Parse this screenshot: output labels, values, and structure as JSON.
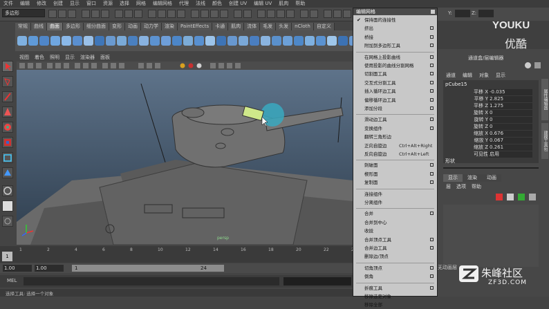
{
  "menubar": [
    "文件",
    "编辑",
    "修改",
    "创建",
    "显示",
    "窗口",
    "资源",
    "选择",
    "网格",
    "编辑网格",
    "代理",
    "法线",
    "颜色",
    "创建 UV",
    "编辑 UV",
    "肌肉",
    "帮助"
  ],
  "mode_select": "多边形",
  "field_labels": {
    "y": "Y:",
    "z": "Z:"
  },
  "shelf_tabs": [
    "常规",
    "曲线",
    "曲面",
    "多边形",
    "细分曲面",
    "变形",
    "动画",
    "动力学",
    "渲染",
    "PaintEffects",
    "卡通",
    "肌肉",
    "流体",
    "毛发",
    "头发",
    "nCloth",
    "自定义"
  ],
  "shelf_active": 2,
  "viewport_menu": [
    "视图",
    "着色",
    "照明",
    "显示",
    "渲染器",
    "面板"
  ],
  "timeline": {
    "ticks": [
      "1",
      "2",
      "4",
      "6",
      "8",
      "10",
      "12",
      "14",
      "16",
      "18",
      "20",
      "22",
      "24"
    ],
    "current_frame": "1",
    "start_field": "1.00",
    "range_start": "1.00",
    "range_box_start": "1",
    "range_box_end": "24",
    "anim_pref_text": "无动画层",
    "mel_label": "MEL",
    "help_text": "选择工具: 选择一个对象"
  },
  "right_panel": {
    "header": "通道盒/层编辑器",
    "tabs": [
      "通道",
      "编辑",
      "对象",
      "显示"
    ],
    "object": "pCube15",
    "channels": [
      {
        "name": "平移 X",
        "value": "-0.035"
      },
      {
        "name": "平移 Y",
        "value": "2.825"
      },
      {
        "name": "平移 Z",
        "value": "1.275"
      },
      {
        "name": "旋转 X",
        "value": "0"
      },
      {
        "name": "旋转 Y",
        "value": "0"
      },
      {
        "name": "旋转 Z",
        "value": "0"
      },
      {
        "name": "缩放 X",
        "value": "0.676"
      },
      {
        "name": "缩放 Y",
        "value": "0.067"
      },
      {
        "name": "缩放 Z",
        "value": "0.261"
      },
      {
        "name": "可见性",
        "value": "启用"
      }
    ],
    "shapes_label": "形状",
    "layer_tabs": [
      "显示",
      "渲染",
      "动画"
    ],
    "layer_menu": [
      "层",
      "选项",
      "帮助"
    ],
    "side_tabs": [
      "属性编辑器",
      "建模工具包"
    ]
  },
  "edit_mesh_menu": {
    "title": "编辑网格",
    "items": [
      {
        "label": "保持面的连接性",
        "check": true,
        "opt": false
      },
      {
        "label": "挤出",
        "opt": true
      },
      {
        "label": "桥接",
        "opt": true
      },
      {
        "label": "附加到多边形工具",
        "opt": true
      },
      {
        "sep": true
      },
      {
        "label": "在网格上投影曲线",
        "opt": true
      },
      {
        "label": "使用投影的曲线分割网格",
        "opt": true
      },
      {
        "label": "切割面工具",
        "opt": true
      },
      {
        "label": "交互式分割工具",
        "opt": true
      },
      {
        "label": "插入循环边工具",
        "opt": true
      },
      {
        "label": "偏移循环边工具",
        "opt": true
      },
      {
        "label": "添加分段",
        "opt": true
      },
      {
        "sep": true
      },
      {
        "label": "滑动边工具",
        "opt": true
      },
      {
        "label": "变换组件",
        "opt": true
      },
      {
        "label": "翻转三角形边",
        "opt": false
      },
      {
        "label": "正向自旋边",
        "shortcut": "Ctrl+Alt+Right",
        "opt": false
      },
      {
        "label": "反向自旋边",
        "shortcut": "Ctrl+Alt+Left",
        "opt": false
      },
      {
        "sep": true
      },
      {
        "label": "刺破面",
        "opt": true
      },
      {
        "label": "楔形面",
        "opt": true
      },
      {
        "label": "复制面",
        "opt": true
      },
      {
        "sep": true
      },
      {
        "label": "连接组件",
        "opt": false
      },
      {
        "label": "分离组件",
        "opt": false
      },
      {
        "sep": true
      },
      {
        "label": "合并",
        "opt": true
      },
      {
        "label": "合并到中心",
        "opt": false
      },
      {
        "label": "收拢",
        "opt": false
      },
      {
        "label": "合并顶点工具",
        "opt": true
      },
      {
        "label": "合并边工具",
        "opt": true
      },
      {
        "label": "删除边/顶点",
        "opt": false
      },
      {
        "sep": true
      },
      {
        "label": "切角顶点",
        "opt": true
      },
      {
        "label": "倒角",
        "opt": true
      },
      {
        "sep": true
      },
      {
        "label": "折痕工具",
        "opt": true
      },
      {
        "label": "移除选定对象",
        "opt": false
      },
      {
        "label": "移除全部",
        "opt": false
      }
    ]
  },
  "watermarks": {
    "youku_latin": "YOUKU",
    "youku_cn": "优酷",
    "zf3d_cn": "朱峰社区",
    "zf3d_url": "ZF3D.COM"
  },
  "viewport_label": "persp",
  "colors": {
    "menu_bg": "#c8c8c8",
    "panel_bg": "#474747",
    "highlight": "#3aa9c0",
    "viewport_top": "#5e738a"
  }
}
